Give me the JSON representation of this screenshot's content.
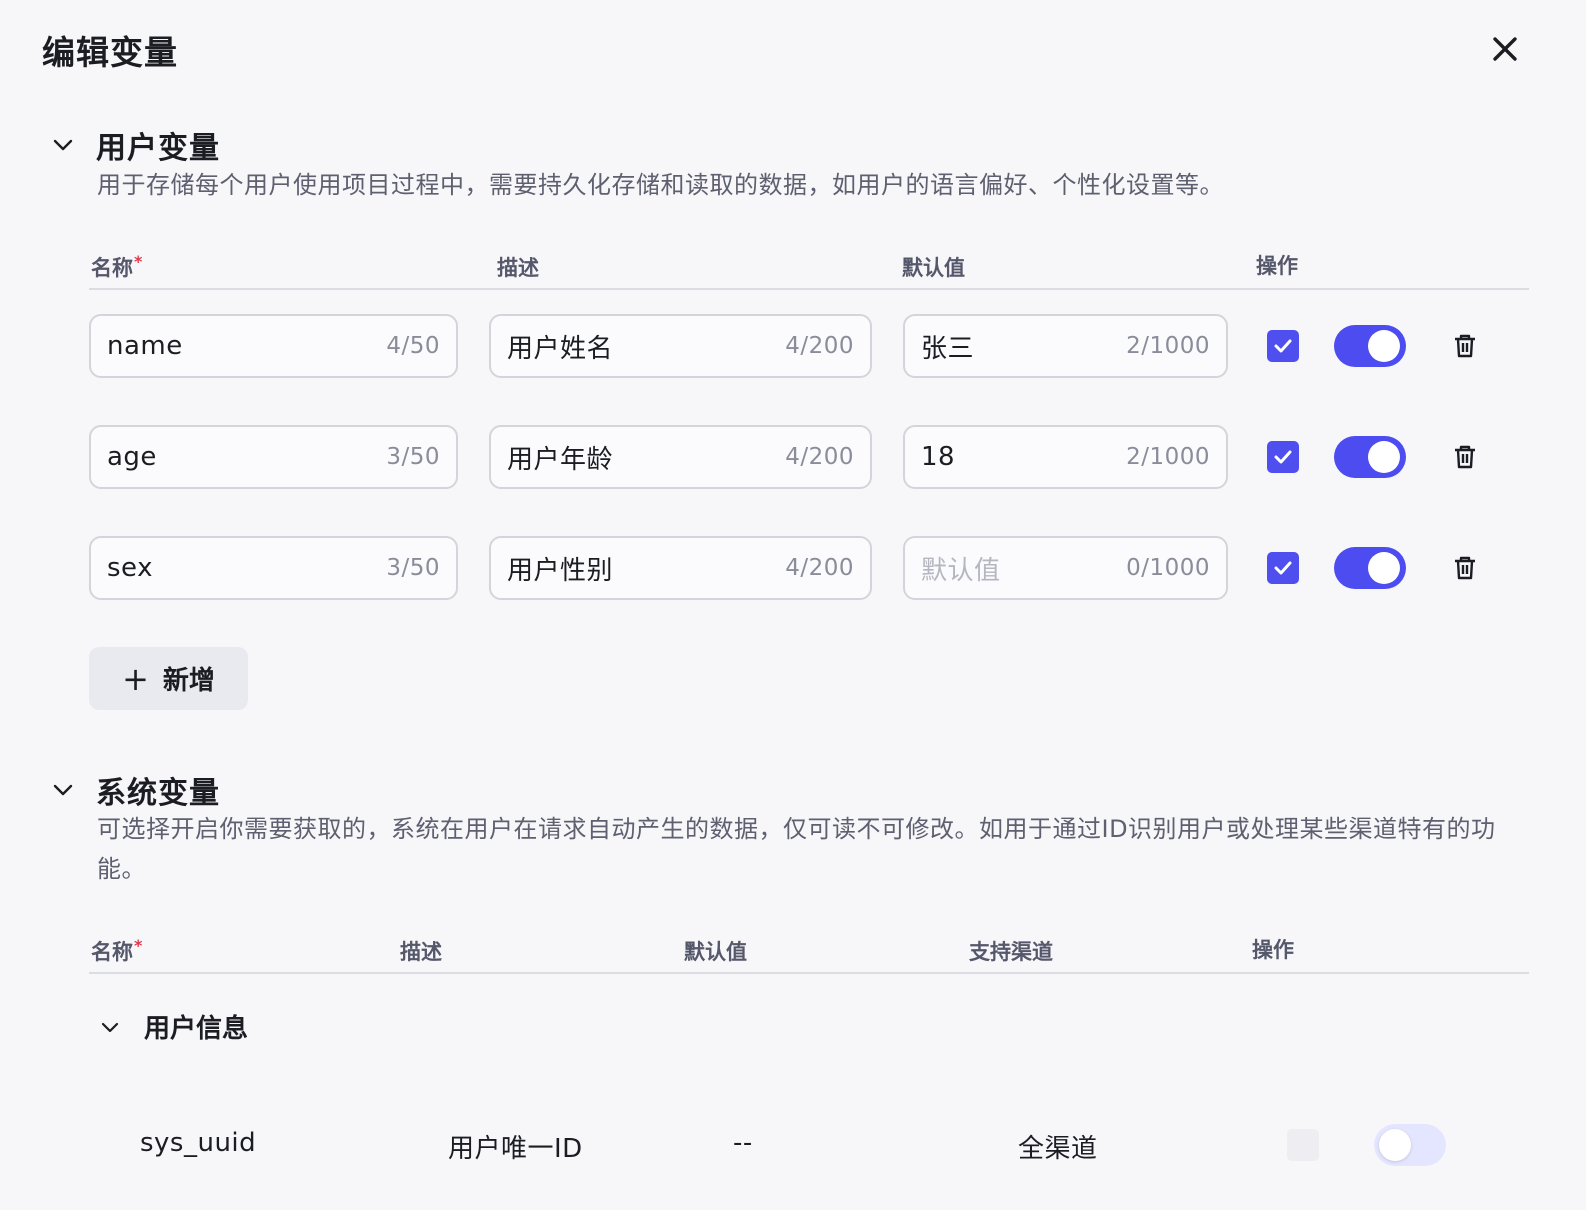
{
  "dialog": {
    "title": "编辑变量"
  },
  "user_section": {
    "title": "用户变量",
    "description": "用于存储每个用户使用项目过程中，需要持久化存储和读取的数据，如用户的语言偏好、个性化设置等。",
    "columns": {
      "name": "名称",
      "required_mark": "*",
      "desc": "描述",
      "default": "默认值",
      "ops": "操作"
    },
    "rows": [
      {
        "name": "name",
        "name_count": "4/50",
        "desc": "用户姓名",
        "desc_count": "4/200",
        "default": "张三",
        "default_count": "2/1000",
        "checked": true,
        "enabled": true
      },
      {
        "name": "age",
        "name_count": "3/50",
        "desc": "用户年龄",
        "desc_count": "4/200",
        "default": "18",
        "default_count": "2/1000",
        "checked": true,
        "enabled": true
      },
      {
        "name": "sex",
        "name_count": "3/50",
        "desc": "用户性别",
        "desc_count": "4/200",
        "default": "",
        "default_placeholder": "默认值",
        "default_count": "0/1000",
        "checked": true,
        "enabled": true
      }
    ],
    "add_button": {
      "icon": "plus-icon",
      "label": "新增"
    }
  },
  "system_section": {
    "title": "系统变量",
    "description": "可选择开启你需要获取的，系统在用户在请求自动产生的数据，仅可读不可修改。如用于通过ID识别用户或处理某些渠道特有的功能。",
    "columns": {
      "name": "名称",
      "required_mark": "*",
      "desc": "描述",
      "default": "默认值",
      "channel": "支持渠道",
      "ops": "操作"
    },
    "group": {
      "title": "用户信息",
      "rows": [
        {
          "name": "sys_uuid",
          "desc": "用户唯一ID",
          "default": "--",
          "channel": "全渠道",
          "checked": false,
          "enabled": false
        }
      ]
    }
  },
  "colors": {
    "accent": "#4f4ff0",
    "required": "#e0384a",
    "background": "#f7f7fa"
  }
}
